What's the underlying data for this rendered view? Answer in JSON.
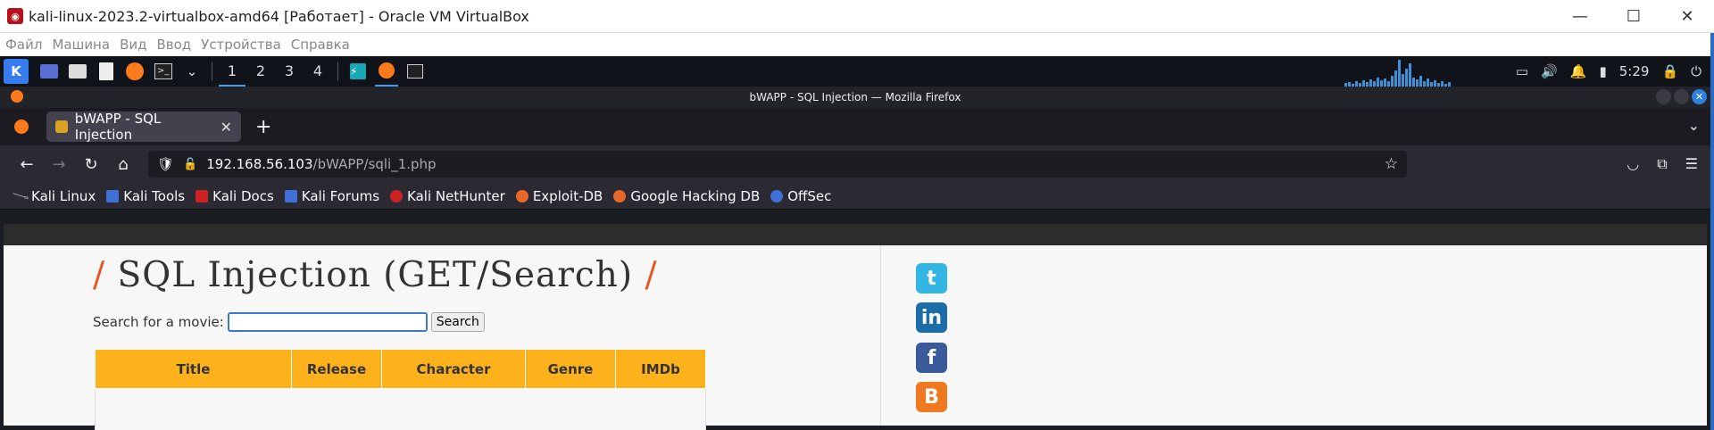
{
  "window": {
    "title": "kali-linux-2023.2-virtualbox-amd64 [Работает] - Oracle VM VirtualBox"
  },
  "vb_menu": [
    "Файл",
    "Машина",
    "Вид",
    "Ввод",
    "Устройства",
    "Справка"
  ],
  "panel": {
    "workspaces": [
      "1",
      "2",
      "3",
      "4"
    ],
    "clock": "5:29"
  },
  "firefox": {
    "window_title": "bWAPP - SQL Injection — Mozilla Firefox",
    "tab_label": "bWAPP - SQL Injection",
    "url_host": "192.168.56.103",
    "url_path": "/bWAPP/sqli_1.php",
    "bookmarks": [
      "Kali Linux",
      "Kali Tools",
      "Kali Docs",
      "Kali Forums",
      "Kali NetHunter",
      "Exploit-DB",
      "Google Hacking DB",
      "OffSec"
    ]
  },
  "page": {
    "title": "SQL Injection (GET/Search)",
    "slash": "/",
    "search_label": "Search for a movie:",
    "search_value": "",
    "search_button": "Search",
    "columns": [
      "Title",
      "Release",
      "Character",
      "Genre",
      "IMDb"
    ]
  },
  "social": [
    "twitter",
    "linkedin",
    "facebook",
    "blogger"
  ]
}
